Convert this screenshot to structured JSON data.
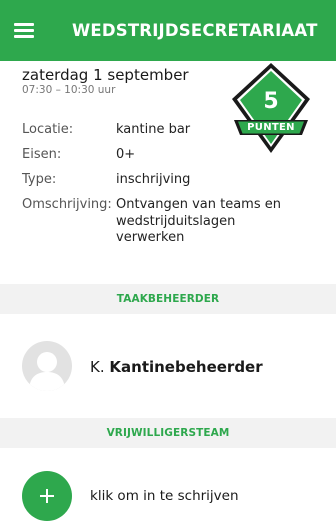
{
  "app_bar": {
    "title": "WEDSTRIJDSECRETARIAAT",
    "menu_icon": "hamburger-menu-icon",
    "color": "#2ea84d"
  },
  "task": {
    "date": "zaterdag 1 september",
    "time": "07:30 – 10:30 uur",
    "points": {
      "value": "5",
      "label": "PUNTEN",
      "badge_color": "#2ea84d",
      "outline_color": "#1a1a1a"
    },
    "details": [
      {
        "label": "Locatie:",
        "value": "kantine bar"
      },
      {
        "label": "Eisen:",
        "value": "0+"
      },
      {
        "label": "Type:",
        "value": "inschrijving"
      },
      {
        "label": "Omschrijving:",
        "value": "Ontvangen van teams en wedstrijduitslagen verwerken"
      }
    ]
  },
  "sections": {
    "task_manager": {
      "title": "TAAKBEHEERDER",
      "initial": "K.",
      "name": "Kantinebeheerder",
      "avatar_icon": "user-silhouette-icon"
    },
    "volunteer_team": {
      "title": "VRIJWILLIGERSTEAM",
      "signup_text": "klik om in te schrijven",
      "add_icon": "plus-icon"
    }
  },
  "colors": {
    "accent": "#2ea84d",
    "section_bg": "#f2f2f2",
    "muted_text": "#777777"
  }
}
